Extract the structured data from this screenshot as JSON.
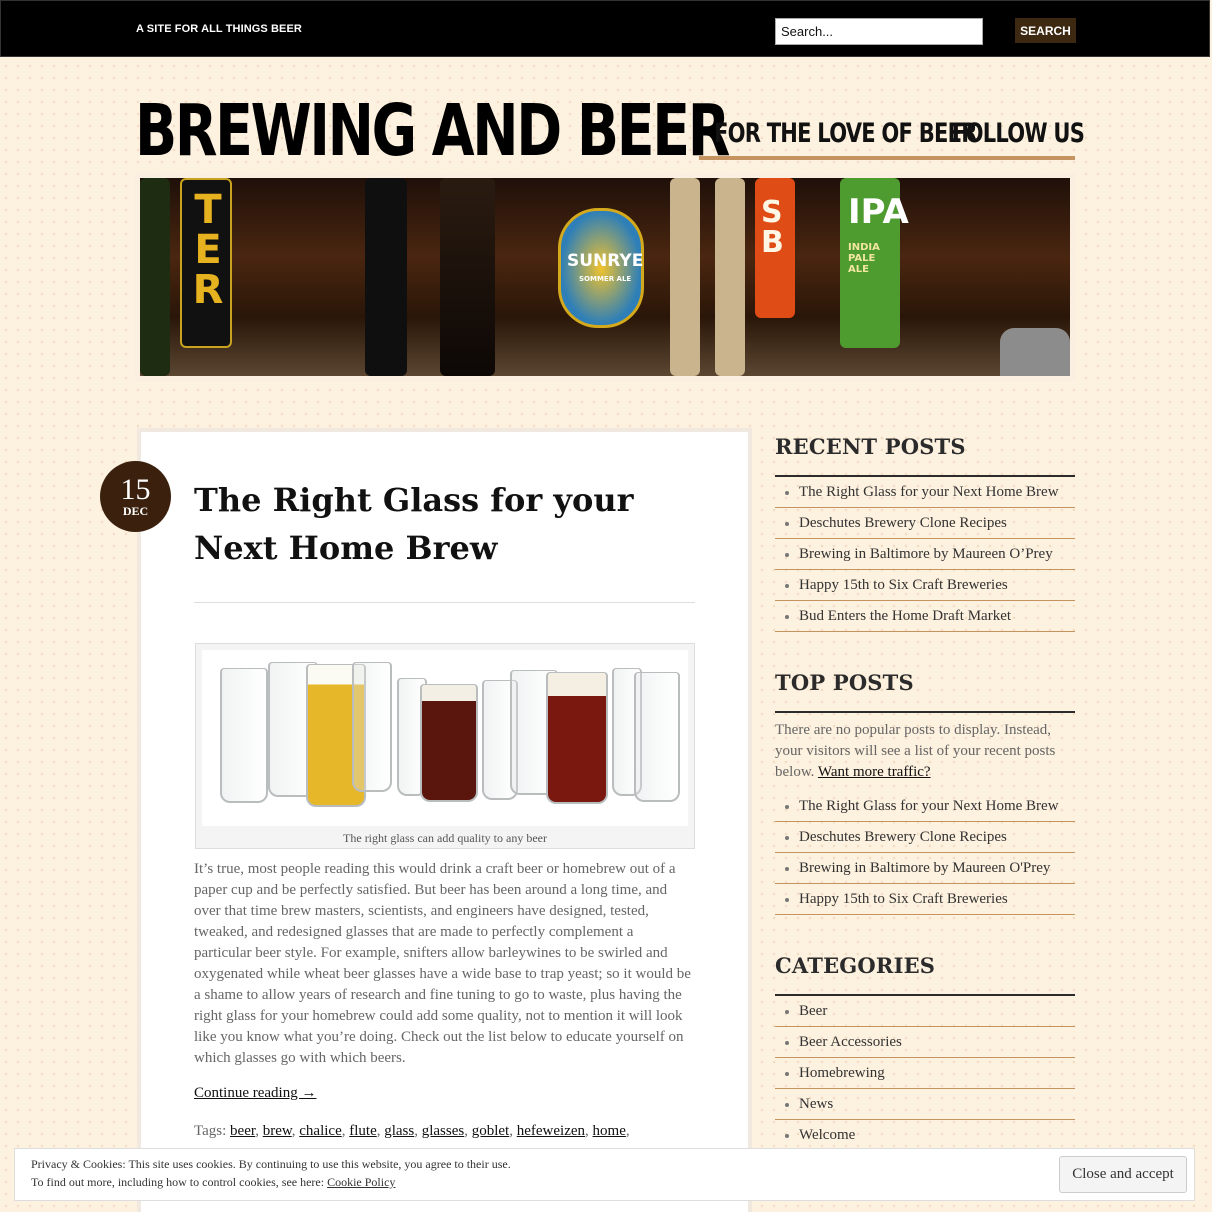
{
  "topbar": {
    "tagline": "A SITE FOR ALL THINGS BEER",
    "search_placeholder": "Search...",
    "search_button": "SEARCH"
  },
  "header": {
    "site_title": "BREWING AND BEER",
    "nav": [
      "FOR THE LOVE OF BEER",
      "FOLLOW US"
    ]
  },
  "banner": {
    "tap_labels": [
      "TER",
      "SUNRYE",
      "SOMMER ALE",
      "SB",
      "IPA",
      "INDIA PALE ALE"
    ]
  },
  "post": {
    "date_day": "15",
    "date_month": "DEC",
    "title": "The Right Glass for your Next Home Brew",
    "image_caption": "The right glass can add quality to any beer",
    "body": "It’s true, most people reading this would drink a craft beer or homebrew out of a paper cup and be perfectly satisfied.  But beer has been around a long time, and over that time brew masters, scientists, and engineers have designed, tested, tweaked, and redesigned glasses that are made to perfectly complement a particular beer style.  For example, snifters allow barleywines to be swirled and oxygenated while wheat beer glasses have a wide base to trap yeast; so it would be a shame to allow years of research and fine tuning to go to waste, plus having the right glass for your homebrew could add some quality, not to mention it will look like you know what you’re doing.  Check out the list below to educate yourself on which glasses go with which beers.",
    "continue_reading": "Continue reading →",
    "tags_label": "Tags:",
    "tags": [
      "beer",
      "brew",
      "chalice",
      "flute",
      "glass",
      "glasses",
      "goblet",
      "hefeweizen",
      "home"
    ]
  },
  "sidebar": {
    "recent_title": "RECENT POSTS",
    "recent_posts": [
      "The Right Glass for your Next Home Brew",
      "Deschutes Brewery Clone Recipes",
      "Brewing in Baltimore by Maureen O’Prey",
      "Happy 15th to Six Craft Breweries",
      "Bud Enters the Home Draft Market"
    ],
    "top_title": "TOP POSTS",
    "top_text": "There are no popular posts to display. Instead, your visitors will see a list of your recent posts below.",
    "top_link": "Want more traffic?",
    "top_posts": [
      "The Right Glass for your Next Home Brew",
      "Deschutes Brewery Clone Recipes",
      "Brewing in Baltimore by Maureen O'Prey",
      "Happy 15th to Six Craft Breweries"
    ],
    "categories_title": "CATEGORIES",
    "categories": [
      "Beer",
      "Beer Accessories",
      "Homebrewing",
      "News",
      "Welcome"
    ]
  },
  "cookie": {
    "line1": "Privacy & Cookies: This site uses cookies. By continuing to use this website, you agree to their use.",
    "line2": "To find out more, including how to control cookies, see here:",
    "policy_link": "Cookie Policy",
    "button": "Close and accept"
  }
}
